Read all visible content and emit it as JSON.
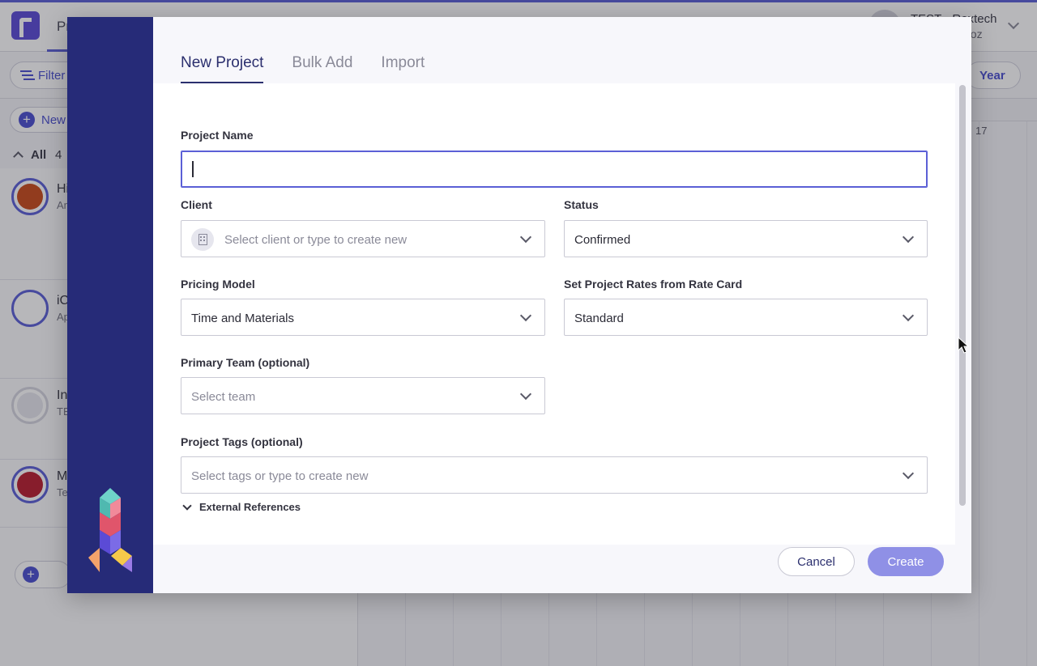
{
  "background_app": {
    "tab": "Pr",
    "user_name": "TEST - Rextech",
    "user_sub": "ñoz",
    "filter_label": "Filter",
    "view_label": "Year",
    "new_label": "New",
    "all_label": "All",
    "all_count": "4",
    "gantt_date": "17",
    "rows": [
      {
        "title": "Hi",
        "sub": "An"
      },
      {
        "title": "iC",
        "sub": "Ap"
      },
      {
        "title": "In",
        "sub": "TE"
      },
      {
        "title": "M",
        "sub": "Te"
      }
    ]
  },
  "modal": {
    "tabs": [
      {
        "label": "New Project",
        "active": true
      },
      {
        "label": "Bulk Add",
        "active": false
      },
      {
        "label": "Import",
        "active": false
      }
    ],
    "fields": {
      "project_name": {
        "label": "Project Name",
        "value": ""
      },
      "client": {
        "label": "Client",
        "placeholder": "Select client or type to create new",
        "icon": "building-icon"
      },
      "status": {
        "label": "Status",
        "value": "Confirmed"
      },
      "pricing_model": {
        "label": "Pricing Model",
        "value": "Time and Materials"
      },
      "rate_card": {
        "label": "Set Project Rates from Rate Card",
        "value": "Standard"
      },
      "primary_team": {
        "label": "Primary Team (optional)",
        "placeholder": "Select team"
      },
      "project_tags": {
        "label": "Project Tags (optional)",
        "placeholder": "Select tags or type to create new"
      }
    },
    "external_references_label": "External References",
    "buttons": {
      "cancel": "Cancel",
      "create": "Create"
    }
  },
  "colors": {
    "rail": "#262b78",
    "accent": "#5b5fd6",
    "create_button": "#8f90e6"
  }
}
